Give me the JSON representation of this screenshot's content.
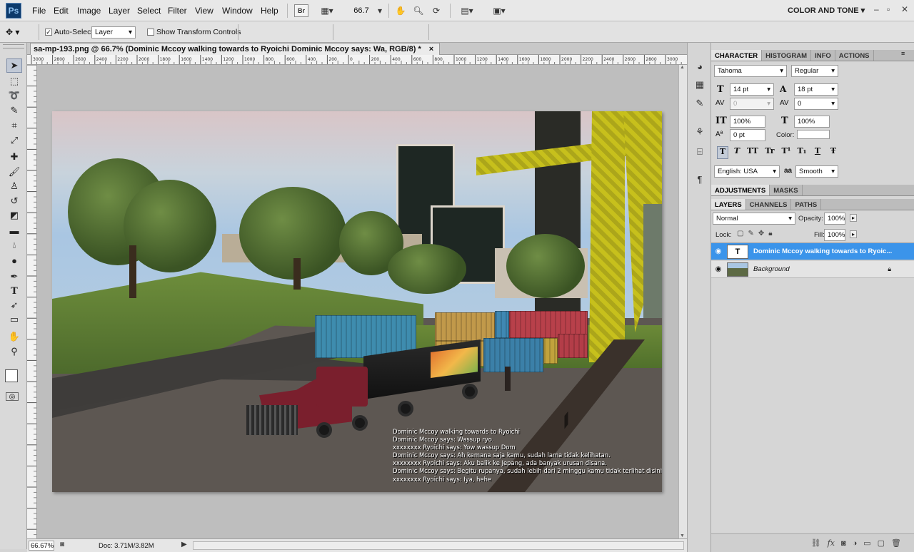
{
  "app": {
    "logo": "Ps",
    "menus": [
      "File",
      "Edit",
      "Image",
      "Layer",
      "Select",
      "Filter",
      "View",
      "Window",
      "Help"
    ],
    "bridge_label": "Br",
    "zoom_value": "66.7",
    "workspace": "COLOR AND TONE"
  },
  "options_bar": {
    "auto_select_label": "Auto-Select:",
    "auto_select_target": "Layer",
    "show_transform_label": "Show Transform Controls"
  },
  "document": {
    "tab_title": "sa-mp-193.png @ 66.7% (Dominic Mccoy walking towards to Ryoichi Dominic Mccoy says: Wa, RGB/8) *",
    "tab_close": "×",
    "ruler_h": [
      "3000",
      "2800",
      "2600",
      "2400",
      "2200",
      "2000",
      "1800",
      "1600",
      "1400",
      "1200",
      "1000",
      "800",
      "600",
      "400",
      "200",
      "0",
      "200",
      "400",
      "600",
      "800",
      "1000",
      "1200",
      "1400",
      "1600",
      "1800",
      "2000",
      "2200",
      "2400",
      "2600",
      "2800",
      "3000"
    ],
    "chat_lines": [
      "Dominic Mccoy walking towards to Ryoichi",
      "Dominic Mccoy says: Wassup ryo.",
      "xxxxxxxx Ryoichi says: Yow wassup Dom",
      "Dominic Mccoy says: Ah kemana saja kamu, sudah lama tidak kelihatan.",
      "xxxxxxxx Ryoichi says: Aku balik ke Jepang, ada banyak urusan disana.",
      "Dominic Mccoy says: Begitu rupanya, sudah lebih dari 2 minggu kamu tidak terlihat disini.",
      "xxxxxxxx Ryoichi says: Iya, hehe"
    ]
  },
  "status": {
    "zoom": "66.67%",
    "doc_size": "Doc: 3.71M/3.82M"
  },
  "character_panel": {
    "tabs": [
      "CHARACTER",
      "HISTOGRAM",
      "INFO",
      "ACTIONS"
    ],
    "font_family": "Tahoma",
    "font_style": "Regular",
    "font_size": "14 pt",
    "leading": "18 pt",
    "kerning": "0",
    "tracking": "0",
    "vertical_scale": "100%",
    "horizontal_scale": "100%",
    "baseline_shift": "0 pt",
    "color_label": "Color:",
    "style_buttons": [
      "T",
      "T",
      "TT",
      "Tr",
      "T¹",
      "T₁",
      "T",
      "Ŧ"
    ],
    "language": "English: USA",
    "aa_label": "aa",
    "antialias": "Smooth"
  },
  "adjust_tabs": [
    "ADJUSTMENTS",
    "MASKS"
  ],
  "layers_panel": {
    "tabs": [
      "LAYERS",
      "CHANNELS",
      "PATHS"
    ],
    "blend_mode": "Normal",
    "opacity_label": "Opacity:",
    "opacity": "100%",
    "lock_label": "Lock:",
    "fill_label": "Fill:",
    "fill": "100%",
    "layers": [
      {
        "name": "Dominic Mccoy walking towards to Ryoic...",
        "type_icon": "T"
      },
      {
        "name": "Background"
      }
    ]
  },
  "colors": {
    "accent": "#3a8ee6",
    "selected_layer": "#3b94ea"
  }
}
